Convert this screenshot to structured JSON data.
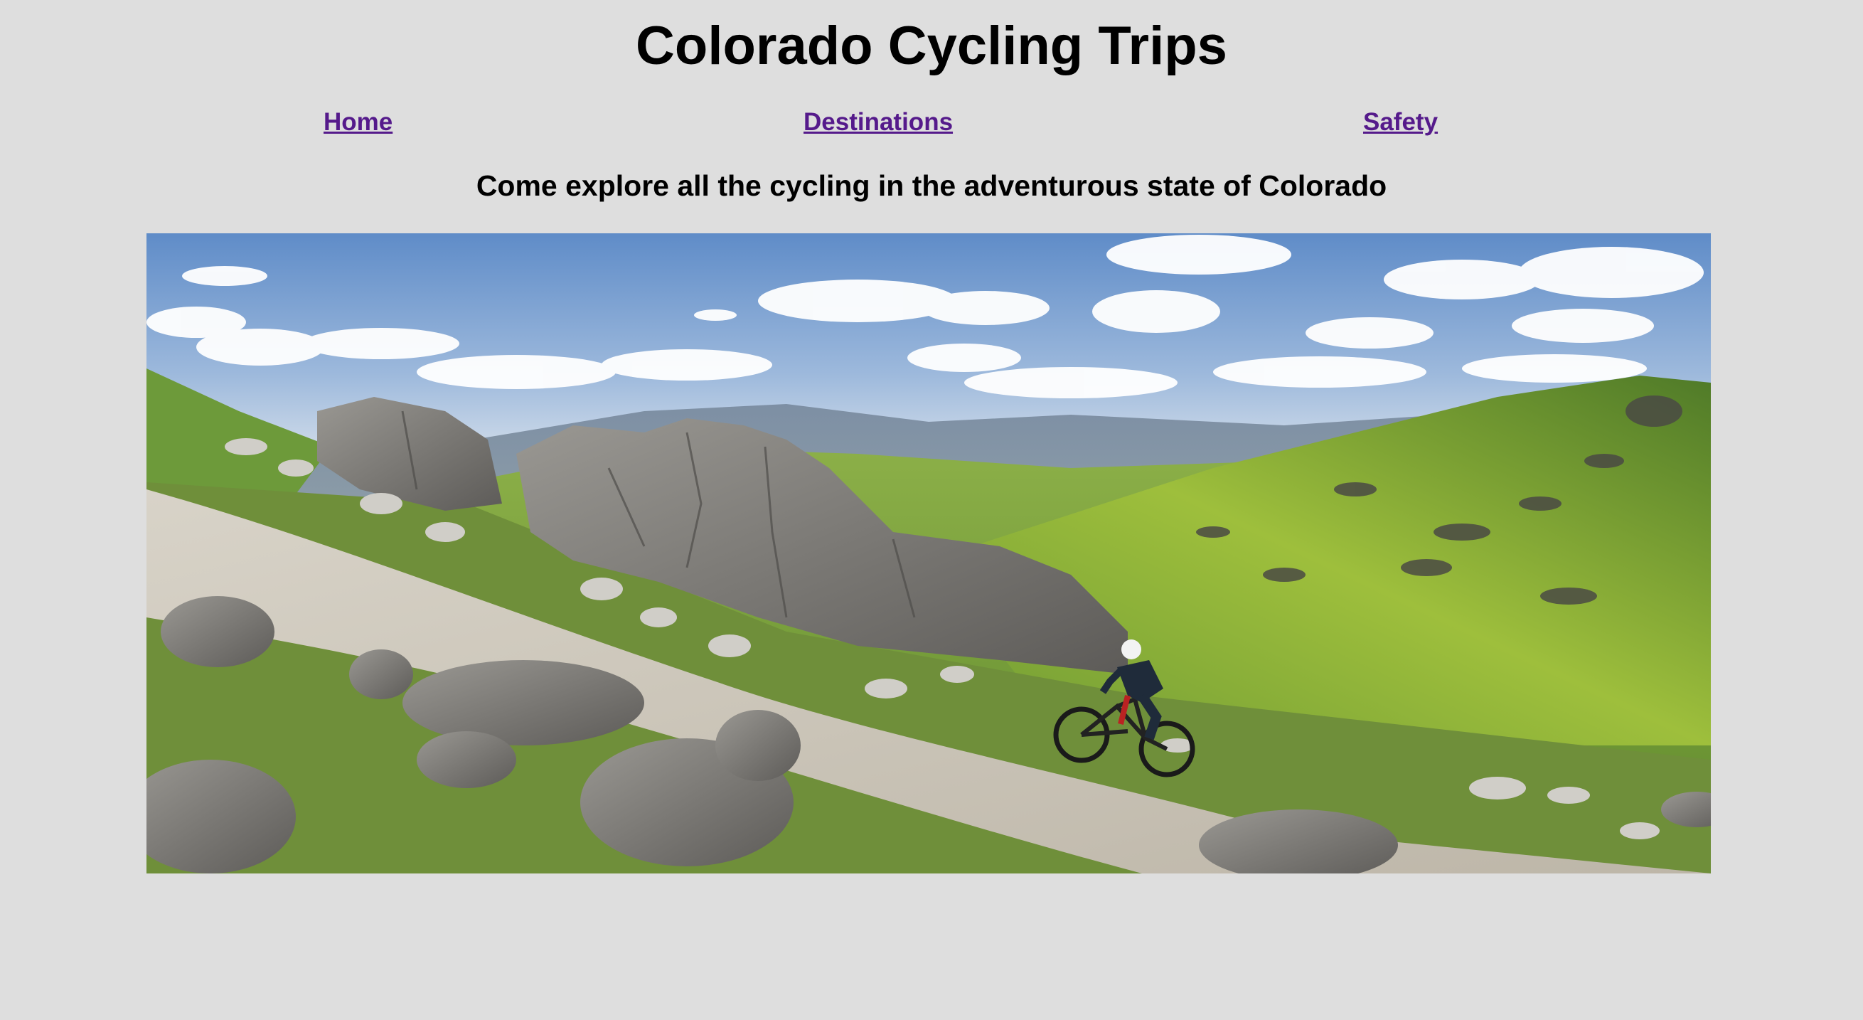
{
  "header": {
    "title": "Colorado Cycling Trips"
  },
  "nav": {
    "items": [
      {
        "label": "Home"
      },
      {
        "label": "Destinations"
      },
      {
        "label": "Safety"
      }
    ],
    "link_color": "#551a8b"
  },
  "main": {
    "tagline": "Come explore all the cycling in the adventurous state of Colorado",
    "hero_image": {
      "subject": "mountain biker on rocky dirt trail through green alpine valley under blue sky with clouds"
    }
  },
  "colors": {
    "background": "#dedede",
    "sky": "#6a93c8",
    "grass": "#7fa63a",
    "rock": "#8c8a86",
    "trail": "#cfc9bd"
  }
}
